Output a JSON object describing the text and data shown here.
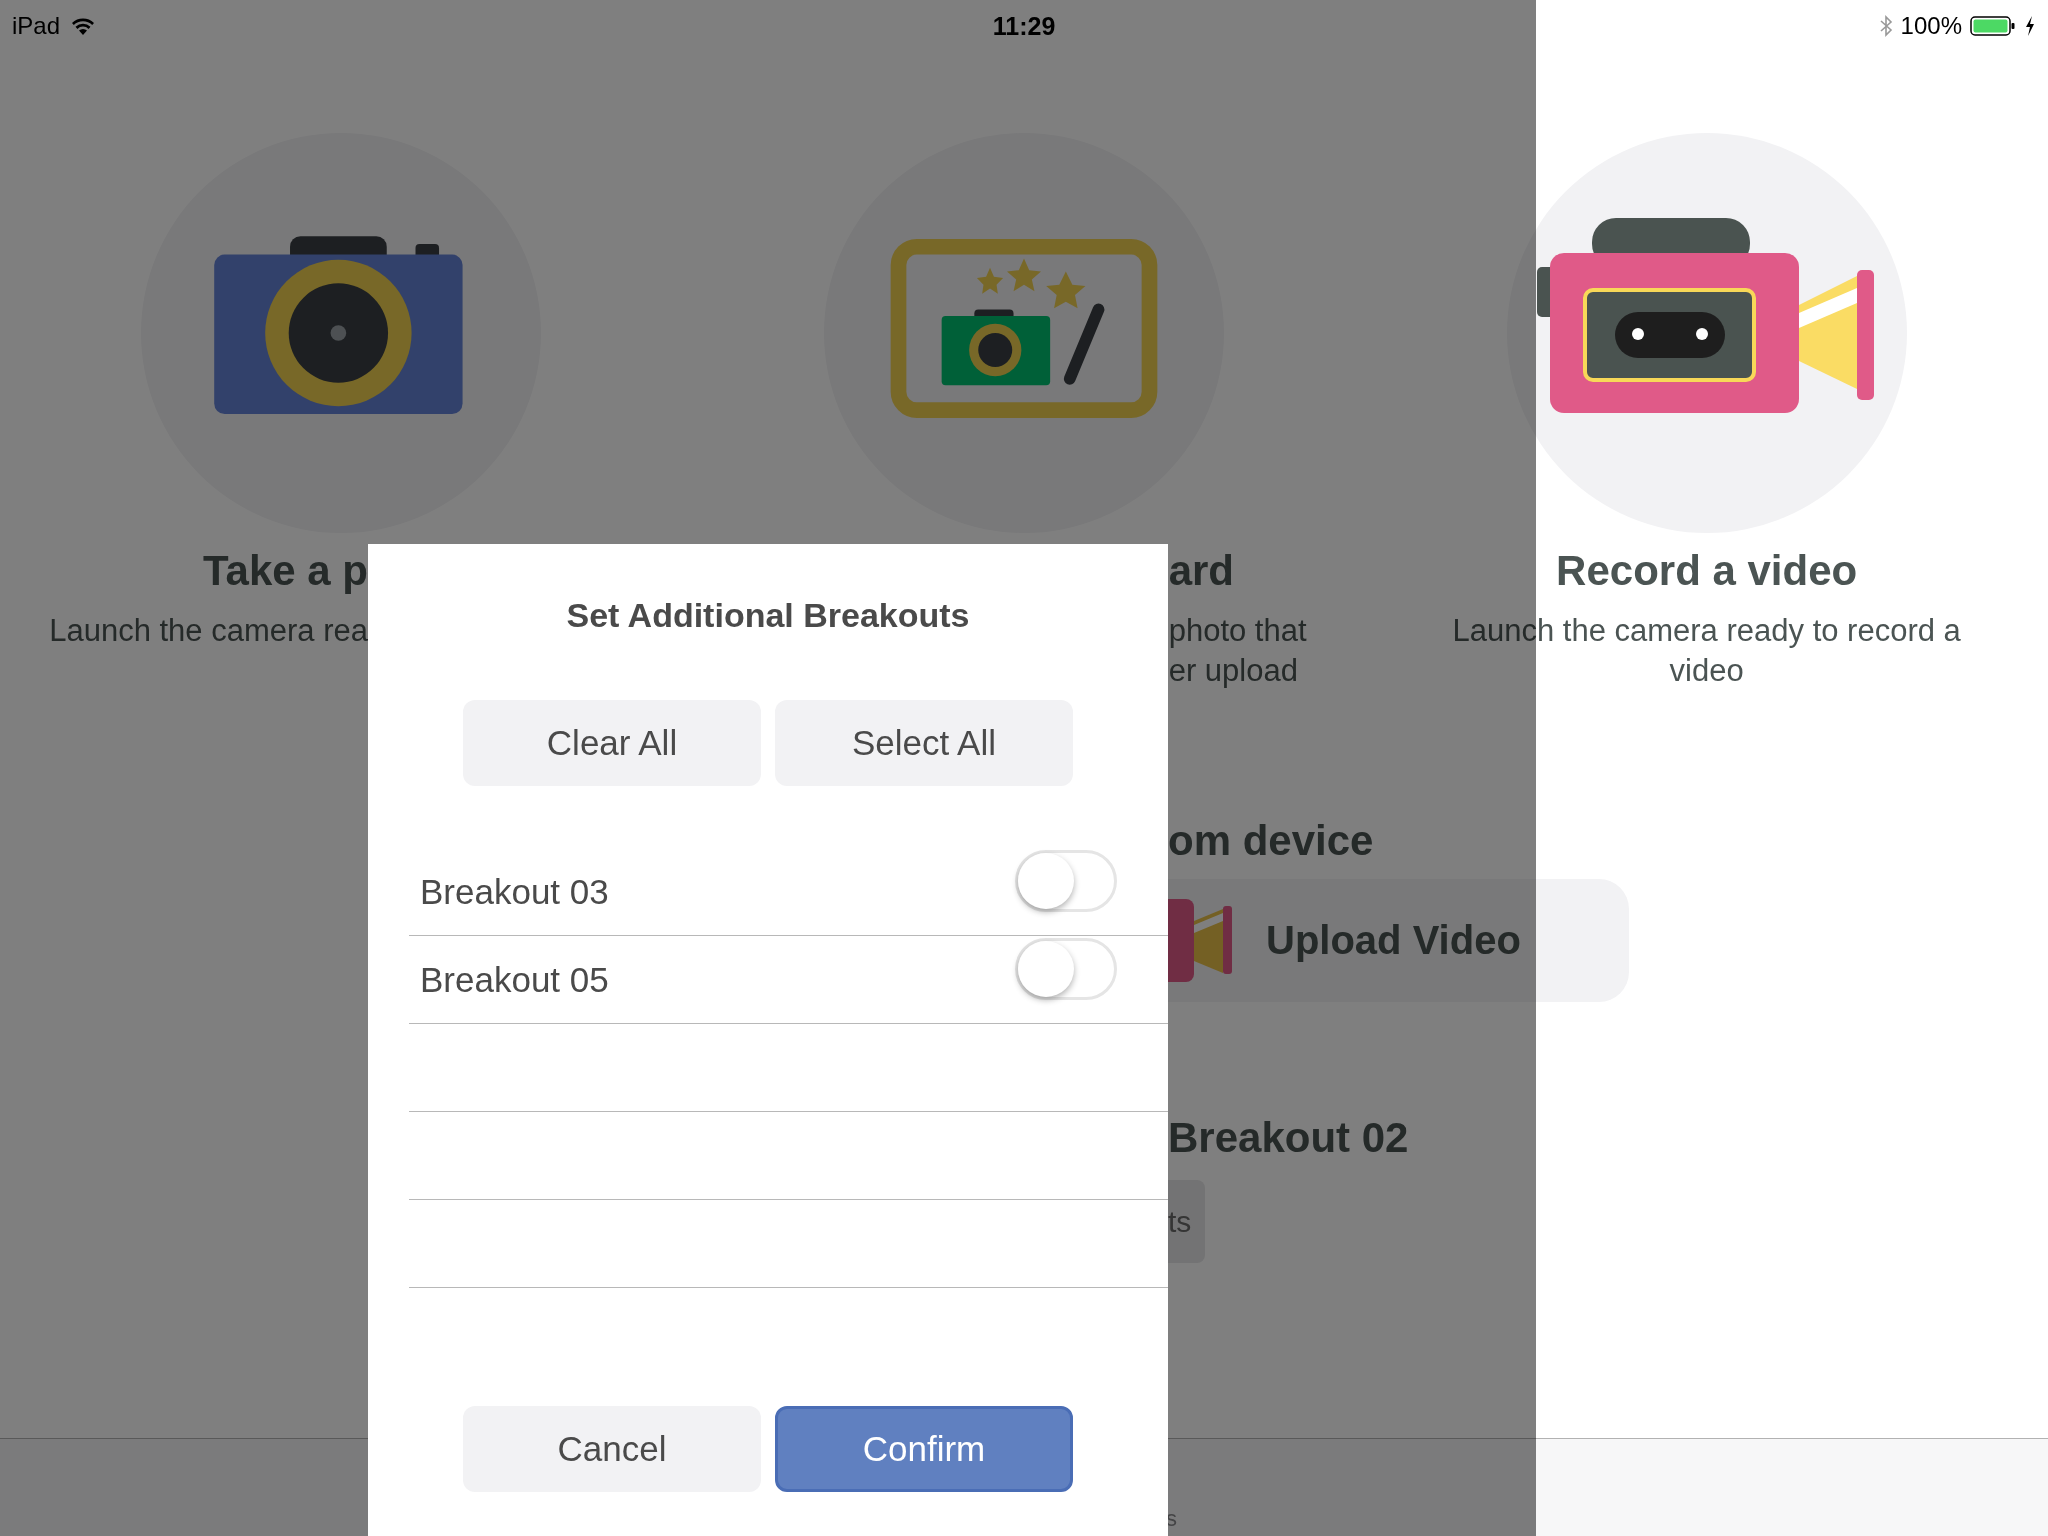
{
  "status_bar": {
    "device": "iPad",
    "time": "11:29",
    "battery": "100%"
  },
  "cards": [
    {
      "kind": "cut-left",
      "title": "Take a p",
      "description": [
        "Launch the camera rea"
      ]
    },
    {
      "kind": "cut-right",
      "title": "ard",
      "description": [
        "photo that",
        "er upload"
      ]
    },
    {
      "kind": "whole",
      "title": "Record a video",
      "description": [
        "Launch the camera ready to record a video"
      ]
    }
  ],
  "upload_section": {
    "heading": "om device",
    "button": "Upload Video"
  },
  "breakout_section": {
    "heading": "Breakout 02",
    "button": "ts"
  },
  "tab_bar": {
    "label": "s"
  },
  "modal": {
    "title": "Set Additional Breakouts",
    "top_buttons": [
      "Clear All",
      "Select All"
    ],
    "rows": [
      {
        "label": "Breakout 03",
        "on": false
      },
      {
        "label": "Breakout 05",
        "on": false
      }
    ],
    "cancel": "Cancel",
    "confirm": "Confirm"
  }
}
